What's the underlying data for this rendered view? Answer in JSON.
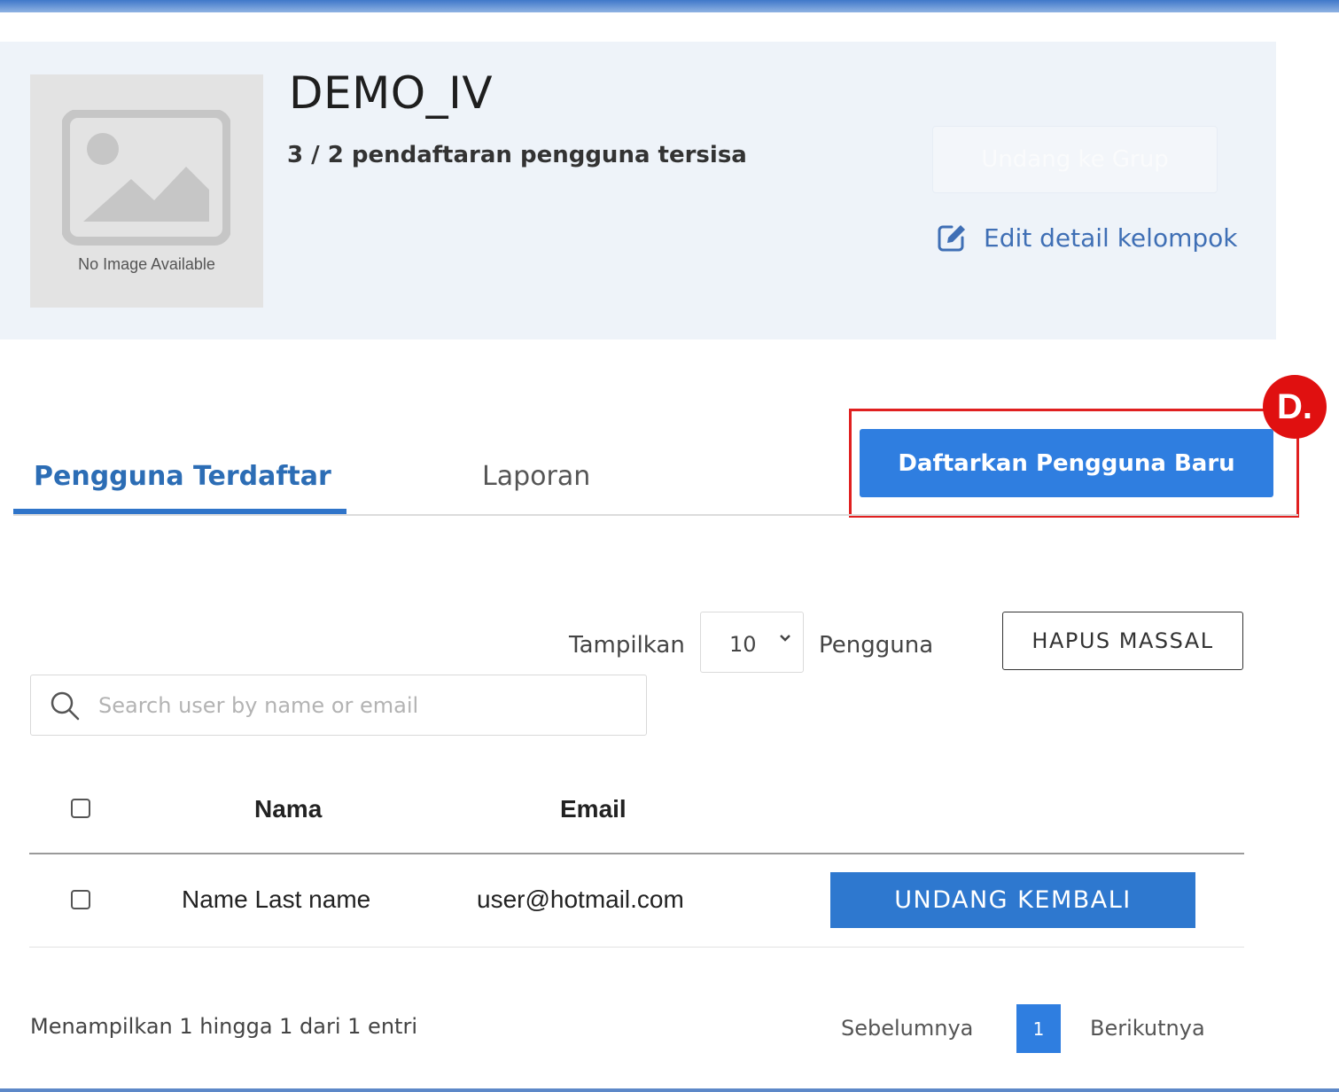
{
  "group": {
    "no_image_text": "No Image Available",
    "name": "DEMO_IV",
    "remaining": "3 / 2 pendaftaran pengguna tersisa",
    "invite_button": "Undang ke Grup",
    "edit_link": "Edit detail kelompok"
  },
  "tabs": [
    {
      "label": "Pengguna Terdaftar",
      "active": true
    },
    {
      "label": "Laporan",
      "active": false
    }
  ],
  "register_button": "Daftarkan Pengguna Baru",
  "annotation_marker": "D.",
  "controls": {
    "show_label": "Tampilkan",
    "page_size": "10",
    "users_label": "Pengguna",
    "bulk_delete": "HAPUS MASSAL",
    "search_placeholder": "Search user by name or email"
  },
  "table": {
    "columns": [
      "Nama",
      "Email"
    ],
    "rows": [
      {
        "name": "Name Last name",
        "email": "user@hotmail.com",
        "action": "UNDANG KEMBALI"
      }
    ]
  },
  "pagination": {
    "info": "Menampilkan 1 hingga 1 dari 1 entri",
    "prev": "Sebelumnya",
    "current": "1",
    "next": "Berikutnya"
  },
  "colors": {
    "primary": "#2f7ee0",
    "highlight": "#e02020",
    "panel": "#eef3f9"
  }
}
